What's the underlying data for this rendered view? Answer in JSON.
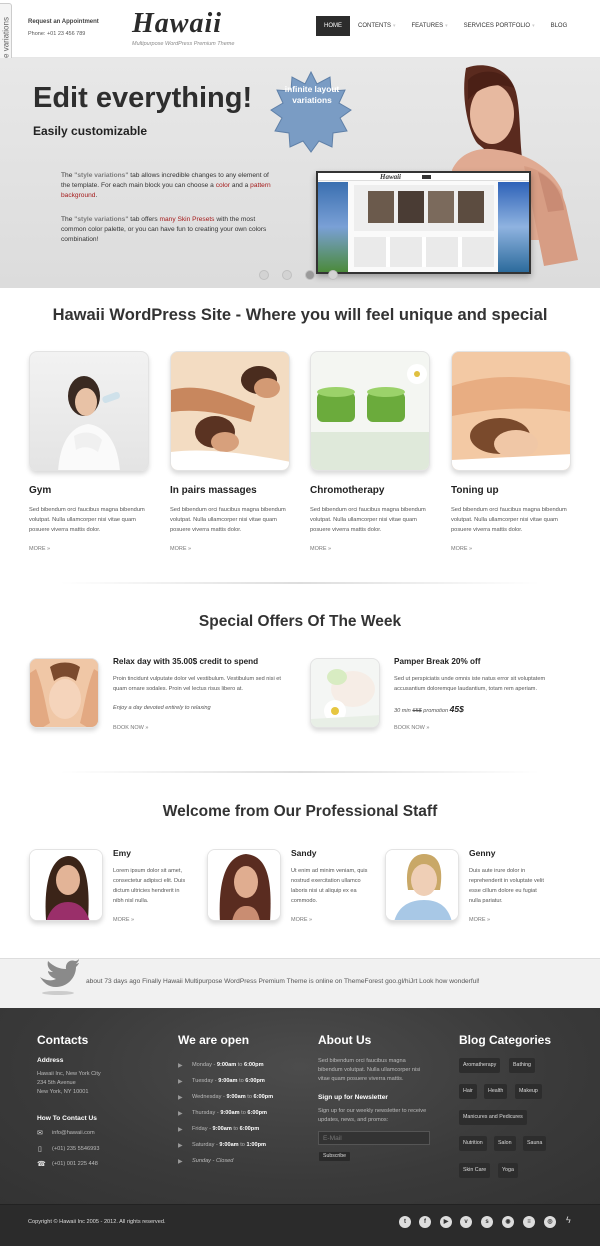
{
  "style_tab": "style variations",
  "header": {
    "request": "Request an Appointment",
    "phone": "Phone: +01 23 456 789",
    "logo": "Hawaii",
    "tagline": "Multipurpose WordPress Premium Theme",
    "nav": [
      "HOME",
      "CONTENTS",
      "FEATURES",
      "SERVICES PORTFOLIO",
      "BLOG"
    ]
  },
  "hero": {
    "title": "Edit everything!",
    "subtitle": "Easily customizable",
    "badge": "infinite layout variations",
    "p1": {
      "a": "The ",
      "kw1": "\"style variations\"",
      "b": " tab allows incredible changes to any element of the template. For each main block you can choose a ",
      "r1": "color",
      "c": " and a ",
      "r2": "pattern background",
      "d": "."
    },
    "p2": {
      "a": "The ",
      "kw": "\"style variations\"",
      "b": " tab offers ",
      "r": "many Skin Presets",
      "c": " with the most common color palette, or you can have fun to creating your own colors combination!"
    },
    "screen_logo": "Hawaii"
  },
  "services": {
    "title": "Hawaii WordPress Site - Where you will feel unique and special",
    "more": "MORE",
    "items": [
      {
        "title": "Gym",
        "text": "Sed bibendum orci faucibus magna bibendum volutpat. Nulla ullamcorper nisi vitae quam posuere viverra mattis dolor."
      },
      {
        "title": "In pairs massages",
        "text": "Sed bibendum orci faucibus magna bibendum volutpat. Nulla ullamcorper nisi vitae quam posuere viverra mattis dolor."
      },
      {
        "title": "Chromotherapy",
        "text": "Sed bibendum orci faucibus magna bibendum volutpat. Nulla ullamcorper nisi vitae quam posuere viverra mattis dolor."
      },
      {
        "title": "Toning up",
        "text": "Sed bibendum orci faucibus magna bibendum volutpat. Nulla ullamcorper nisi vitae quam posuere viverra mattis dolor."
      }
    ]
  },
  "offers": {
    "title": "Special Offers Of The Week",
    "book": "BOOK NOW",
    "items": [
      {
        "title": "Relax day with 35.00$ credit to spend",
        "text": "Proin tincidunt vulputate dolor vel vestibulum. Vestibulum sed nisi et quam ornare sodales. Proin vel lectus risus libero at.",
        "note": "Enjoy a day devoted entirely to relaxing"
      },
      {
        "title": "Pamper Break 20% off",
        "text": "Sed ut perspiciatis unde omnis iste natus error sit voluptatem accusantium doloremque laudantium, totam rem aperiam.",
        "note_a": "30 min ",
        "note_old": "65$",
        "note_b": " promotion ",
        "note_price": "45$"
      }
    ]
  },
  "staff": {
    "title": "Welcome from Our Professional Staff",
    "more": "MORE",
    "items": [
      {
        "name": "Emy",
        "text": "Lorem ipsum dolor sit amet, consectetur adipisci elit. Duis dictum ultricies hendrerit in nibh nisl nulla."
      },
      {
        "name": "Sandy",
        "text": "Ut enim ad minim veniam, quis nostrud exercitation ullamco laboris nisi ut aliquip ex ea commodo."
      },
      {
        "name": "Genny",
        "text": "Duis aute irure dolor in reprehenderit in voluptate velit esse cillum dolore eu fugiat nulla pariatur."
      }
    ]
  },
  "tweet": {
    "text": "about 73 days ago Finally Hawaii Multipurpose WordPress Premium Theme is online on ThemeForest ",
    "link": "goo.gl/hiJrt",
    "tail": " Look how wonderful!"
  },
  "footer": {
    "contacts": {
      "title": "Contacts",
      "address_label": "Address",
      "address": [
        "Hawaii Inc, New York City",
        "234 5th Avenue",
        "New York, NY 10001"
      ],
      "how_label": "How To Contact Us",
      "email": "info@hawaii.com",
      "phone1": "(+01) 235 5546993",
      "phone2": "(+01) 001 225 448"
    },
    "open": {
      "title": "We are open",
      "rows": [
        {
          "day": "Monday",
          "from": "9:00am",
          "to": "6:00pm"
        },
        {
          "day": "Tuesday",
          "from": "9:00am",
          "to": "6:00pm"
        },
        {
          "day": "Wednesday",
          "from": "9:00am",
          "to": "6:00pm"
        },
        {
          "day": "Thursday",
          "from": "9:00am",
          "to": "6:00pm"
        },
        {
          "day": "Friday",
          "from": "9:00am",
          "to": "6:00pm"
        },
        {
          "day": "Saturday",
          "from": "9:00am",
          "to": "1:00pm"
        }
      ],
      "sunday": "Sunday - Closed"
    },
    "about": {
      "title": "About Us",
      "text": "Sed bibendum orci faucibus magna bibendum volutpat. Nulla ullamcorper nisi vitae quam posuere viverra mattis.",
      "newsletter_title": "Sign up for Newsletter",
      "newsletter_text": "Sign up for our weekly newsletter to receive updates, news, and promos:",
      "placeholder": "E-Mail",
      "subscribe": "Subscribe"
    },
    "blog": {
      "title": "Blog Categories",
      "tags": [
        "Aromatherapy",
        "Bathing",
        "Hair",
        "Health",
        "Makeup",
        "Manicures and Pedicures",
        "Nutrition",
        "Salon",
        "Sauna",
        "Skin Care",
        "Yoga"
      ]
    },
    "copyright": "Copyright © Hawaii Inc 2005 - 2012. All rights reserved."
  }
}
